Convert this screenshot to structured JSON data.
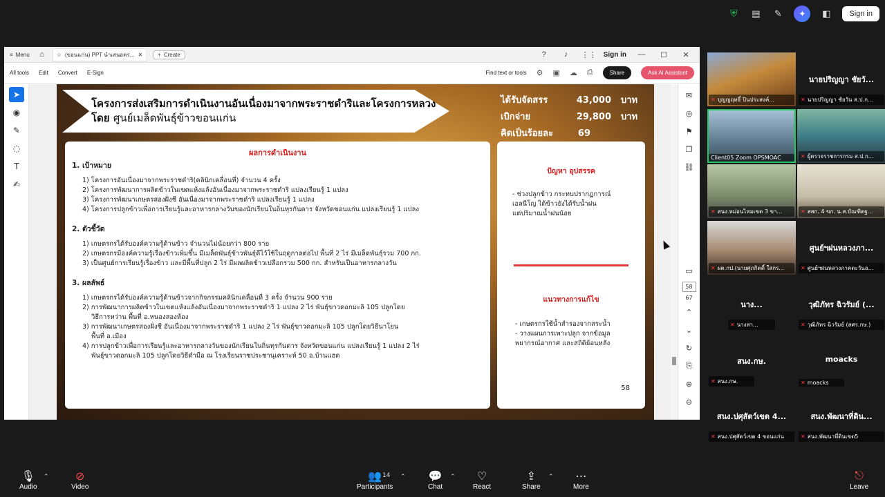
{
  "zoom_top": {
    "signin_label": "Sign in"
  },
  "acrobat": {
    "menu_label": "Menu",
    "tab_title": "(ขอนแก่น) PPT นำเสนอคร...",
    "create_label": "Create",
    "signin_label": "Sign in",
    "menu_items": [
      "All tools",
      "Edit",
      "Convert",
      "E-Sign"
    ],
    "find_label": "Find text or tools",
    "share_label": "Share",
    "ai_label": "Ask AI Assistant",
    "page_current": "58",
    "page_total": "67"
  },
  "slide": {
    "banner_line1": "โครงการส่งเสริมการดำเนินงานอันเนื่องมาจากพระราชดำริและโครงการหลวง",
    "banner_line2_prefix": "โดย",
    "banner_line2_rest": "ศูนย์เมล็ดพันธุ์ข้าวขอนแก่น",
    "budget": [
      {
        "label": "ได้รับจัดสรร",
        "value": "43,000",
        "unit": "บาท"
      },
      {
        "label": "เบิกจ่าย",
        "value": "29,800",
        "unit": "บาท"
      },
      {
        "label": "คิดเป็นร้อยละ",
        "value": "69",
        "unit": ""
      }
    ],
    "main_title": "ผลการดำเนินงาน",
    "sec1_title": "1. เป้าหมาย",
    "sec1_items": [
      "1) โครงการอันเนื่องมาจากพระราชดำริ(คลินิกเคลื่อนที่) จำนวน 4 ครั้ง",
      "2) โครงการพัฒนาการผลิตข้าวในเขตแห้งแล้งอันเนื่องมาจากพระราชดำริ แปลงเรียนรู้ 1 แปลง",
      "3) โครงการพัฒนาเกษตรสองฝั่งชี อันเนื่องมาจากพระราชดำริ แปลงเรียนรู้ 1 แปลง",
      "4) โครงการปลูกข้าวเพื่อการเรียนรู้และอาหารกลางวันของนักเรียนในถิ่นทุรกันดาร จังหวัดขอนแก่น แปลงเรียนรู้ 1 แปลง"
    ],
    "sec2_title": "2. ตัวชี้วัด",
    "sec2_items": [
      "1) เกษตรกรได้รับองค์ความรู้ด้านข้าว จำนวนไม่น้อยกว่า 800 ราย",
      "2) เกษตรกรมีองค์ความรู้เรื่องข้าวเพิ่มขึ้น มีเมล็ดพันธุ์ข้าวพันธุ์ดีไว้ใช้ในฤดูกาลต่อไป พื้นที่ 2 ไร่ มีเมล็ดพันธุ์รวม 700 กก.",
      "3) เป็นศูนย์การเรียนรู้เรื่องข้าว และมีพื้นที่ปลูก 2 ไร่ มีผลผลิตข้าวเปลือกรวม 500 กก. สำหรับเป็นอาหารกลางวัน"
    ],
    "sec3_title": "3. ผลลัพธ์",
    "sec3_items": [
      "1) เกษตรกรได้รับองค์ความรู้ด้านข้าวจากกิจกรรมคลินิกเคลื่อนที่ 3 ครั้ง จำนวน 900 ราย",
      "2) การพัฒนาการผลิตข้าวในเขตแห้งแล้งอันเนื่องมาจากพระราชดำริ 1 แปลง 2 ไร่ พันธุ์ขาวดอกมะลิ 105 ปลูกโดย",
      "วิธีการหว่าน พื้นที่ อ.หนองสองห้อง",
      "3) การพัฒนาเกษตรสองฝั่งชี อันเนื่องมาจากพระราชดำริ 1 แปลง 2 ไร่ พันธุ์ขาวดอกมะลิ 105 ปลูกโดยวิธีนาโยน",
      "พื้นที่ อ.เมือง",
      "4) การปลูกข้าวเพื่อการเรียนรู้และอาหารกลางวันของนักเรียนในถิ่นทุรกันดาร จังหวัดขอนแก่น แปลงเรียนรู้ 1 แปลง 2 ไร่",
      "พันธุ์ขาวดอกมะลิ 105 ปลูกโดยวิธีดำมือ ณ โรงเรียนราชประชานุเคราะห์ 50 อ.บ้านแฮด"
    ],
    "problem_title": "ปัญหา อุปสรรค",
    "problem_lines": [
      "- ช่วงปลูกข้าว กระทบปรากฏการณ์",
      "เอลนีโญ ได้ข้าวยังได้รับน้ำฝน",
      "แต่ปริมาณน้ำฝนน้อย"
    ],
    "solution_title": "แนวทางการแก้ไข",
    "solution_lines": [
      "- เกษตรกรใช้น้ำสำรองจากสระน้ำ",
      "- วางแผนการเพาะปลูก จากข้อมูล",
      "พยากรณ์อากาศ และสถิติย้อนหลัง"
    ],
    "page_num": "58"
  },
  "gallery": {
    "tiles": [
      {
        "name": "บุญญฤทธิ์ ปินประสงค์...",
        "big": "",
        "type": "video"
      },
      {
        "name": "นายปริญญา ชัยวัน ส.ป.ก...",
        "big": "นายปริญญา ชัยวั...",
        "type": "name"
      },
      {
        "name": "Client05 Zoom OPSMOAC",
        "big": "",
        "type": "video"
      },
      {
        "name": "ผู้ตรวจราชการกรม ส.ป.ก...",
        "big": "",
        "type": "video"
      },
      {
        "name": "สนง.หม่อนไหมเขต 3 ขา...",
        "big": "",
        "type": "video"
      },
      {
        "name": "สสก. 4 ขก. น.ส.บัณฑิตฐ...",
        "big": "",
        "type": "video"
      },
      {
        "name": "ผต.กป.(นายศุภกิตติ์ ใสกร...",
        "big": "",
        "type": "video"
      },
      {
        "name": "ศูนย์ฯฝนหลวงภาคตะวันอ...",
        "big": "ศูนย์ฯฝนหลวงภา...",
        "type": "name"
      },
      {
        "name": "นางสา...",
        "big": "นาง...",
        "type": "name"
      },
      {
        "name": "วุฒิภัทร ฉิวรัมย์ (สศร.กษ.)",
        "big": "วุฒิภัทร ฉิวรัมย์ (...",
        "type": "name"
      },
      {
        "name": "สนง.กษ.",
        "big": "สนง.กษ.",
        "type": "name"
      },
      {
        "name": "moacks",
        "big": "moacks",
        "type": "name"
      },
      {
        "name": "สนง.ปศุสัตว์เขต 4 ขอนแก่น",
        "big": "สนง.ปศุสัตว์เขต 4...",
        "type": "name"
      },
      {
        "name": "สนง.พัฒนาที่ดินเขต5",
        "big": "สนง.พัฒนาที่ดิน...",
        "type": "name"
      }
    ]
  },
  "bottombar": {
    "audio_label": "Audio",
    "video_label": "Video",
    "participants_label": "Participants",
    "participants_count": "14",
    "chat_label": "Chat",
    "react_label": "React",
    "share_label": "Share",
    "more_label": "More",
    "leave_label": "Leave"
  },
  "colors": {
    "accent_red": "#d62020",
    "acrobat_blue": "#1473e6",
    "ai_button": "#e5546b",
    "active_speaker": "#22c55e"
  }
}
